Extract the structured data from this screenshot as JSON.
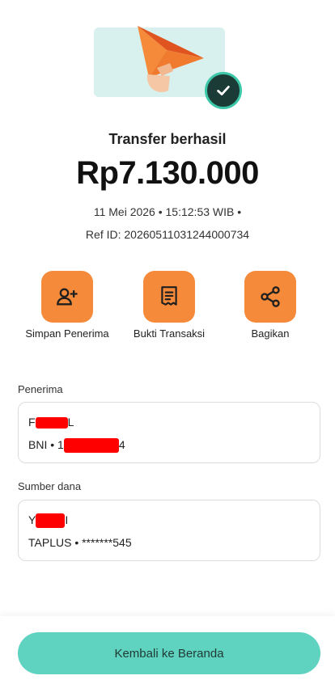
{
  "receipt": {
    "status_title": "Transfer berhasil",
    "amount": "Rp7.130.000",
    "date_time": "11 Mei 2026 • 15:12:53 WIB •",
    "ref_id": "Ref ID: 20260511031244000734"
  },
  "actions": [
    {
      "label": "Simpan Penerima",
      "icon": "add-user-icon"
    },
    {
      "label": "Bukti Transaksi",
      "icon": "receipt-icon"
    },
    {
      "label": "Bagikan",
      "icon": "share-icon"
    }
  ],
  "recipient": {
    "section_label": "Penerima",
    "name_prefix": "F",
    "name_suffix": "L",
    "bank_prefix": "BNI • 1",
    "account_suffix": "4"
  },
  "source": {
    "section_label": "Sumber dana",
    "name_prefix": "Y",
    "name_suffix": "I",
    "account": "TAPLUS • *******545"
  },
  "footer": {
    "home_button": "Kembali ke Beranda"
  },
  "colors": {
    "accent_orange": "#f58a3a",
    "accent_teal": "#5fd3bf",
    "redaction": "#ff0000"
  }
}
